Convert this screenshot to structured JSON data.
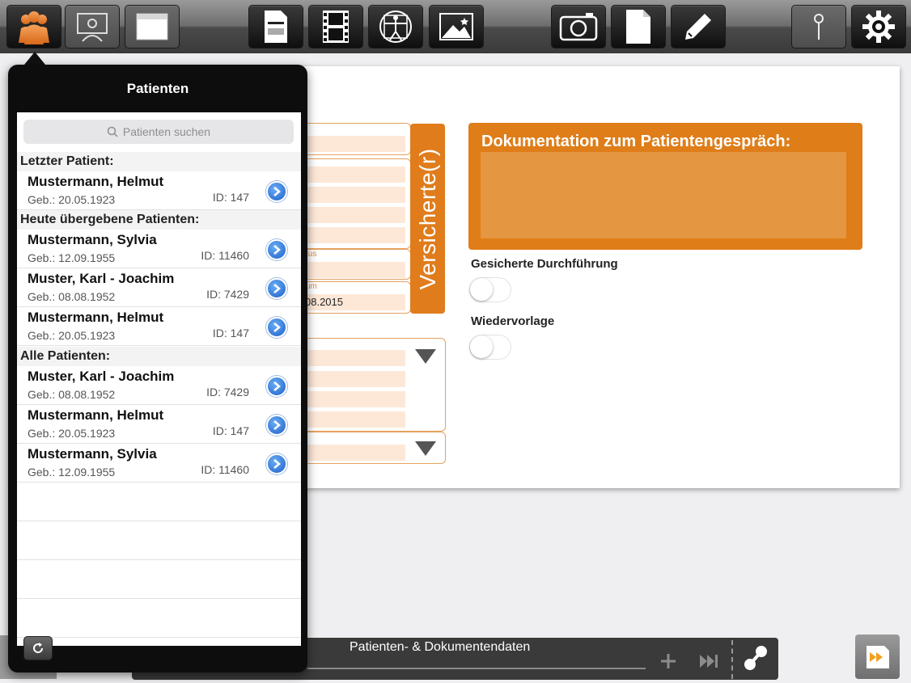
{
  "toolbar": {
    "buttons": [
      {
        "name": "patients-icon"
      },
      {
        "name": "presentation-icon"
      },
      {
        "name": "folder-icon"
      },
      {
        "name": "document-icon"
      },
      {
        "name": "film-icon"
      },
      {
        "name": "vitruvian-man-icon"
      },
      {
        "name": "image-icon"
      },
      {
        "name": "camera-icon"
      },
      {
        "name": "blank-page-icon"
      },
      {
        "name": "pencil-icon"
      },
      {
        "name": "pin-icon"
      },
      {
        "name": "gear-icon"
      }
    ]
  },
  "popover": {
    "title": "Patienten",
    "search_placeholder": "Patienten suchen",
    "sections": {
      "last": "Letzter Patient:",
      "today": "Heute übergebene Patienten:",
      "all": "Alle Patienten:"
    },
    "patients": [
      {
        "name": "Mustermann, Helmut",
        "geb": "Geb.: 20.05.1923",
        "id": "ID: 147"
      },
      {
        "name": "Mustermann, Sylvia",
        "geb": "Geb.: 12.09.1955",
        "id": "ID: 11460"
      },
      {
        "name": "Muster, Karl - Joachim",
        "geb": "Geb.: 08.08.1952",
        "id": "ID: 7429"
      },
      {
        "name": "Mustermann, Helmut",
        "geb": "Geb.: 20.05.1923",
        "id": "ID: 147"
      },
      {
        "name": "Muster, Karl - Joachim",
        "geb": "Geb.: 08.08.1952",
        "id": "ID: 7429"
      },
      {
        "name": "Mustermann, Helmut",
        "geb": "Geb.: 20.05.1923",
        "id": "ID: 147"
      },
      {
        "name": "Mustermann, Sylvia",
        "geb": "Geb.: 12.09.1955",
        "id": "ID: 11460"
      }
    ]
  },
  "form": {
    "insured_tab": "Versicherte(r)",
    "status_label_partial": "tus",
    "date_label_partial": "um",
    "date_value_partial": "08.2015"
  },
  "documentation": {
    "title": "Dokumentation zum Patientengespräch:",
    "text": ""
  },
  "switches": {
    "confirmed": {
      "label": "Gesicherte Durchführung",
      "on": false
    },
    "resubmission": {
      "label": "Wiedervorlage",
      "on": false
    }
  },
  "bottom": {
    "title": "Patienten- & Dokumentendaten"
  },
  "colors": {
    "accent": "#df7d18",
    "field_fill": "#fde8d8",
    "disclosure_blue": "#1c5fc8"
  }
}
